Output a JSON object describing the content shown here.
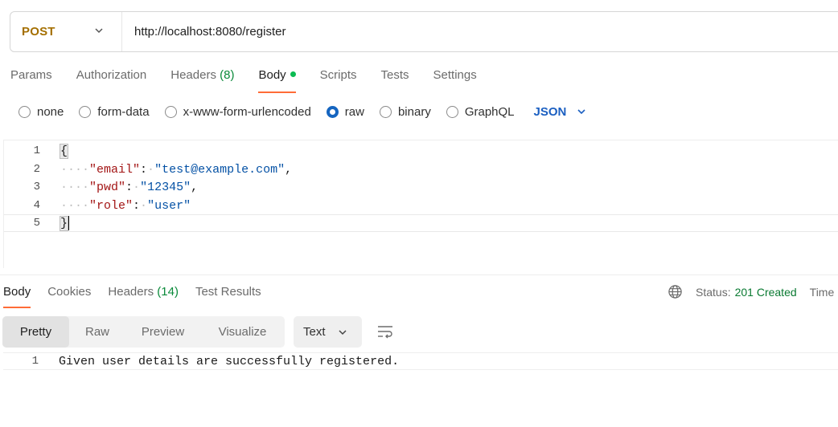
{
  "request": {
    "method": "POST",
    "url": "http://localhost:8080/register"
  },
  "request_tabs": [
    {
      "label": "Params"
    },
    {
      "label": "Authorization"
    },
    {
      "label": "Headers",
      "count": "(8)"
    },
    {
      "label": "Body",
      "active": true
    },
    {
      "label": "Scripts"
    },
    {
      "label": "Tests"
    },
    {
      "label": "Settings"
    }
  ],
  "body_types": [
    {
      "label": "none",
      "checked": false
    },
    {
      "label": "form-data",
      "checked": false
    },
    {
      "label": "x-www-form-urlencoded",
      "checked": false
    },
    {
      "label": "raw",
      "checked": true
    },
    {
      "label": "binary",
      "checked": false
    },
    {
      "label": "GraphQL",
      "checked": false
    }
  ],
  "raw_format": "JSON",
  "editor": {
    "line_numbers": [
      "1",
      "2",
      "3",
      "4",
      "5"
    ],
    "open_brace": "{",
    "close_brace": "}",
    "fields": [
      {
        "key": "\"email\"",
        "value": "\"test@example.com\"",
        "comma": ","
      },
      {
        "key": "\"pwd\"",
        "value": "\"12345\"",
        "comma": ","
      },
      {
        "key": "\"role\"",
        "value": "\"user\"",
        "comma": ""
      }
    ]
  },
  "response_tabs": [
    {
      "label": "Body",
      "active": true
    },
    {
      "label": "Cookies"
    },
    {
      "label": "Headers",
      "count": "(14)"
    },
    {
      "label": "Test Results"
    }
  ],
  "status": {
    "label": "Status:",
    "value": "201 Created",
    "time_label": "Time"
  },
  "view_modes": [
    "Pretty",
    "Raw",
    "Preview",
    "Visualize"
  ],
  "response_format": "Text",
  "response": {
    "line_number": "1",
    "text": "Given user details are successfully registered."
  },
  "colors": {
    "method": "#a46f00",
    "accent_tab": "#ff6c37",
    "dot": "#0cbb52",
    "status_ok": "#0a7a32",
    "json_key": "#a31515",
    "json_string": "#0451a5",
    "radio_checked": "#1565c0"
  },
  "icons": {
    "method_dropdown": "chevron-down-icon",
    "format_dropdown": "chevron-down-icon",
    "globe": "globe-icon",
    "wrap": "wrap-lines-icon"
  }
}
